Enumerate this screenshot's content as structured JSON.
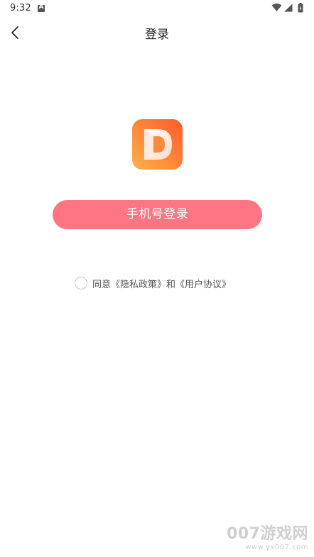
{
  "status_bar": {
    "time": "9:32"
  },
  "nav": {
    "title": "登录"
  },
  "login": {
    "phone_login_label": "手机号登录"
  },
  "agreement": {
    "prefix": "同意",
    "privacy_policy": "《隐私政策》",
    "conjunction": "和",
    "user_agreement": "《用户协议》"
  },
  "watermark": {
    "brand": "007游戏网",
    "url": "www.yx007.com"
  },
  "colors": {
    "primary_button": "#ff7583",
    "logo_gradient_start": "#ffb14a",
    "logo_gradient_end": "#ff5a2a"
  }
}
